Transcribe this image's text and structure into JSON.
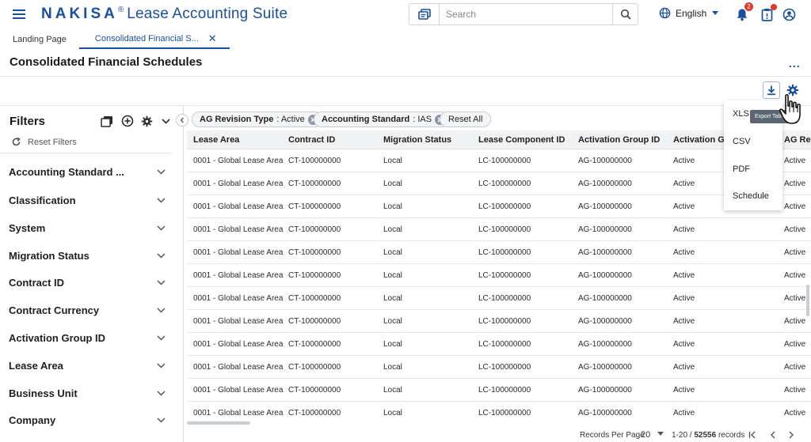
{
  "app": {
    "brand_logo": "NAKISA",
    "brand_reg": "®",
    "brand_suite": "Lease Accounting Suite"
  },
  "header": {
    "search_placeholder": "Search",
    "language": "English",
    "notification_count": "2",
    "icons": [
      "menu-icon",
      "search-type-icon",
      "search-icon",
      "globe-icon",
      "bell-icon",
      "clipboard-icon",
      "user-icon"
    ]
  },
  "tabs": [
    {
      "label": "Landing Page",
      "active": false
    },
    {
      "label": "Consolidated Financial S...",
      "active": true
    }
  ],
  "page": {
    "title": "Consolidated Financial Schedules",
    "more": "..."
  },
  "filters": {
    "title": "Filters",
    "reset_label": "Reset Filters",
    "items": [
      "Accounting Standard ...",
      "Classification",
      "System",
      "Migration Status",
      "Contract ID",
      "Contract Currency",
      "Activation Group ID",
      "Lease Area",
      "Business Unit",
      "Company"
    ]
  },
  "chips": [
    {
      "label": "AG Revision Type",
      "value": ": Active"
    },
    {
      "label": "Accounting Standard",
      "value": ": IAS"
    }
  ],
  "reset_all": "Reset All",
  "table": {
    "columns": [
      "Lease Area",
      "Contract ID",
      "Migration Status",
      "Lease Component ID",
      "Activation Group ID",
      "Activation Gr",
      "AG Re"
    ],
    "rows": [
      [
        "0001 - Global Lease Area",
        "CT-100000000",
        "Local",
        "LC-100000000",
        "AG-100000000",
        "Active",
        "Active"
      ],
      [
        "0001 - Global Lease Area",
        "CT-100000000",
        "Local",
        "LC-100000000",
        "AG-100000000",
        "Active",
        "Active"
      ],
      [
        "0001 - Global Lease Area",
        "CT-100000000",
        "Local",
        "LC-100000000",
        "AG-100000000",
        "Active",
        "Active"
      ],
      [
        "0001 - Global Lease Area",
        "CT-100000000",
        "Local",
        "LC-100000000",
        "AG-100000000",
        "Active",
        "Active"
      ],
      [
        "0001 - Global Lease Area",
        "CT-100000000",
        "Local",
        "LC-100000000",
        "AG-100000000",
        "Active",
        "Active"
      ],
      [
        "0001 - Global Lease Area",
        "CT-100000000",
        "Local",
        "LC-100000000",
        "AG-100000000",
        "Active",
        "Active"
      ],
      [
        "0001 - Global Lease Area",
        "CT-100000000",
        "Local",
        "LC-100000000",
        "AG-100000000",
        "Active",
        "Active"
      ],
      [
        "0001 - Global Lease Area",
        "CT-100000000",
        "Local",
        "LC-100000000",
        "AG-100000000",
        "Active",
        "Active"
      ],
      [
        "0001 - Global Lease Area",
        "CT-100000000",
        "Local",
        "LC-100000000",
        "AG-100000000",
        "Active",
        "Active"
      ],
      [
        "0001 - Global Lease Area",
        "CT-100000000",
        "Local",
        "LC-100000000",
        "AG-100000000",
        "Active",
        "Active"
      ],
      [
        "0001 - Global Lease Area",
        "CT-100000000",
        "Local",
        "LC-100000000",
        "AG-100000000",
        "Active",
        "Active"
      ],
      [
        "0001 - Global Lease Area",
        "CT-100000000",
        "Local",
        "LC-100000000",
        "AG-100000000",
        "Active",
        "Active"
      ]
    ]
  },
  "footer": {
    "rpp_label": "Records Per Page",
    "rpp_value": "20",
    "records_range": "1-20 / ",
    "records_total": "52556",
    "records_suffix": " records"
  },
  "export_menu": {
    "items": [
      "XLS",
      "CSV",
      "PDF",
      "Schedule"
    ],
    "tooltip": "Export Table"
  },
  "colors": {
    "brand": "#1a4fa0",
    "badge": "#e03a2f",
    "header_bg": "#f1f2f4"
  }
}
